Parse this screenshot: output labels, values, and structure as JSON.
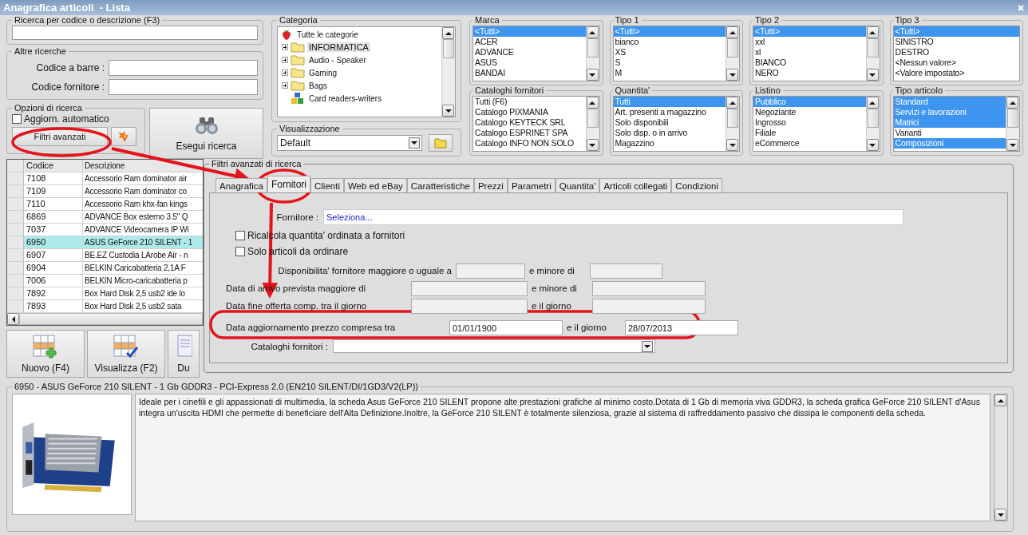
{
  "window": {
    "title": "Anagrafica articoli  - Lista"
  },
  "quick_search": {
    "label": "Ricerca per codice o descrizione (F3)"
  },
  "other_searches": {
    "title": "Altre ricerche",
    "fields": [
      {
        "label": "Codice a barre :"
      },
      {
        "label": "Codice fornitore :"
      }
    ]
  },
  "search_options": {
    "title": "Opzioni di ricerca",
    "auto_update": {
      "label": "Aggiorn. automatico",
      "checked": false
    },
    "advanced_button": "Filtri avanzati"
  },
  "run_button": "Esegui ricerca",
  "category": {
    "title": "Categoria",
    "items": [
      {
        "label": "Tutte le categorie",
        "kind": "root",
        "selected": false
      },
      {
        "label": "INFORMATICA",
        "kind": "folder",
        "selected": true,
        "expanded": false
      },
      {
        "label": "Audio - Speaker",
        "kind": "folder",
        "selected": false,
        "expanded": false
      },
      {
        "label": "Gaming",
        "kind": "folder",
        "selected": false,
        "expanded": false
      },
      {
        "label": "Bags",
        "kind": "folder",
        "selected": false,
        "expanded": false
      },
      {
        "label": "Card readers-writers",
        "kind": "device",
        "selected": false
      }
    ]
  },
  "view": {
    "title": "Visualizzazione",
    "value": "Default"
  },
  "filters": [
    {
      "title": "Marca",
      "scrollable": true,
      "items": [
        {
          "label": "<Tutti>",
          "selected": true
        },
        {
          "label": "ACER",
          "selected": false
        },
        {
          "label": "ADVANCE",
          "selected": false
        },
        {
          "label": "ASUS",
          "selected": false
        },
        {
          "label": "BANDAI",
          "selected": false
        }
      ]
    },
    {
      "title": "Tipo 1",
      "scrollable": true,
      "items": [
        {
          "label": "<Tutti>",
          "selected": true
        },
        {
          "label": "bianco",
          "selected": false
        },
        {
          "label": "XS",
          "selected": false
        },
        {
          "label": "S",
          "selected": false
        },
        {
          "label": "M",
          "selected": false
        }
      ]
    },
    {
      "title": "Tipo 2",
      "scrollable": true,
      "items": [
        {
          "label": "<Tutti>",
          "selected": true
        },
        {
          "label": "xxl",
          "selected": false
        },
        {
          "label": "xl",
          "selected": false
        },
        {
          "label": "BIANCO",
          "selected": false
        },
        {
          "label": "NERO",
          "selected": false
        }
      ]
    },
    {
      "title": "Tipo 3",
      "scrollable": false,
      "items": [
        {
          "label": "<Tutti>",
          "selected": true
        },
        {
          "label": "SINISTRO",
          "selected": false
        },
        {
          "label": "DESTRO",
          "selected": false
        },
        {
          "label": "<Nessun valore>",
          "selected": false
        },
        {
          "label": "<Valore impostato>",
          "selected": false
        }
      ]
    },
    {
      "title": "Cataloghi fornitori",
      "scrollable": true,
      "items": [
        {
          "label": "Tutti (F6)",
          "selected": false
        },
        {
          "label": "Catalogo PIXMANIA",
          "selected": false
        },
        {
          "label": "Catalogo KEYTECK SRL",
          "selected": false
        },
        {
          "label": "Catalogo ESPRINET SPA",
          "selected": false
        },
        {
          "label": "Catalogo INFO NON SOLO",
          "selected": false
        }
      ]
    },
    {
      "title": "Quantita'",
      "scrollable": true,
      "items": [
        {
          "label": "Tutti",
          "selected": true
        },
        {
          "label": "Art. presenti a magazzino",
          "selected": false
        },
        {
          "label": "Solo disponibili",
          "selected": false
        },
        {
          "label": "Solo disp. o in arrivo",
          "selected": false
        },
        {
          "label": "Magazzino",
          "selected": false
        }
      ]
    },
    {
      "title": "Listino",
      "scrollable": true,
      "items": [
        {
          "label": "Pubblico",
          "selected": true
        },
        {
          "label": "Negoziante",
          "selected": false
        },
        {
          "label": "Ingrosso",
          "selected": false
        },
        {
          "label": "Filiale",
          "selected": false
        },
        {
          "label": "eCommerce",
          "selected": false
        }
      ]
    },
    {
      "title": "Tipo articolo",
      "scrollable": true,
      "items": [
        {
          "label": "Standard",
          "selected": true
        },
        {
          "label": "Servizi e lavorazioni",
          "selected": true
        },
        {
          "label": "Matrici",
          "selected": true
        },
        {
          "label": "Varianti",
          "selected": false
        },
        {
          "label": "Composizioni",
          "selected": true
        }
      ]
    }
  ],
  "table": {
    "columns": [
      "Codice",
      "Descrizione"
    ],
    "rows": [
      {
        "code": "7108",
        "description": "Accessorio Ram dominator air",
        "selected": false
      },
      {
        "code": "7109",
        "description": "Accessorio Ram dominator co",
        "selected": false
      },
      {
        "code": "7110",
        "description": "Accessorio Ram khx-fan kings",
        "selected": false
      },
      {
        "code": "6869",
        "description": "ADVANCE Box esterno 3.5\" Q",
        "selected": false
      },
      {
        "code": "7037",
        "description": "ADVANCE Videocamera IP Wi",
        "selected": false
      },
      {
        "code": "6950",
        "description": "ASUS GeForce 210 SILENT - 1",
        "selected": true
      },
      {
        "code": "6907",
        "description": "BE.EZ Custodia LArobe Air - n",
        "selected": false
      },
      {
        "code": "6904",
        "description": "BELKIN Caricabatteria 2,1A F",
        "selected": false
      },
      {
        "code": "7006",
        "description": "BELKIN Micro-caricabatteria p",
        "selected": false
      },
      {
        "code": "7892",
        "description": "Box Hard Disk 2,5  usb2 ide lo",
        "selected": false
      },
      {
        "code": "7893",
        "description": "Box Hard Disk 2,5  usb2 sata",
        "selected": false
      }
    ]
  },
  "actions": [
    {
      "label": "Nuovo (F4)",
      "kind": "new"
    },
    {
      "label": "Visualizza (F2)",
      "kind": "view"
    },
    {
      "label": "Du",
      "kind": "duplicate"
    }
  ],
  "advanced": {
    "title": "Filtri avanzati di ricerca",
    "tabs": [
      {
        "label": "Anagrafica",
        "selected": false
      },
      {
        "label": "Fornitori",
        "selected": true
      },
      {
        "label": "Clienti",
        "selected": false
      },
      {
        "label": "Web ed eBay",
        "selected": false
      },
      {
        "label": "Caratteristiche",
        "selected": false
      },
      {
        "label": "Prezzi",
        "selected": false
      },
      {
        "label": "Parametri",
        "selected": false
      },
      {
        "label": "Quantita'",
        "selected": false
      },
      {
        "label": "Articoli collegati",
        "selected": false
      },
      {
        "label": "Condizioni",
        "selected": false
      }
    ],
    "supplier": {
      "label": "Fornitore :",
      "value": "Seleziona..."
    },
    "checkboxes": [
      {
        "label": "Ricalcola quantita' ordinata a fornitori",
        "checked": false
      },
      {
        "label": "Solo articoli da ordinare",
        "checked": false
      }
    ],
    "ranges": [
      {
        "label": "Disponibilita' fornitore maggiore o uguale a",
        "from": {
          "disabled": true
        },
        "joiner": "e minore di",
        "to": {
          "disabled": true
        }
      },
      {
        "label": "Data di arrivo prevista maggiore di",
        "from": {
          "disabled": true
        },
        "joiner": "e minore di",
        "to": {
          "disabled": true
        }
      },
      {
        "label": "Data fine offerta comp. tra il giorno",
        "from": {
          "disabled": true
        },
        "joiner": "e il giorno",
        "to": {
          "disabled": true
        }
      },
      {
        "label": "Data aggiornamento prezzo compresa tra",
        "from": {
          "value": "01/01/1900",
          "disabled": false
        },
        "joiner": "e il giorno",
        "to": {
          "value": "28/07/2013",
          "disabled": false
        }
      }
    ],
    "catalogs": {
      "label": "Cataloghi fornitori :"
    }
  },
  "detail": {
    "title": "6950 - ASUS GeForce 210 SILENT - 1 Gb GDDR3 - PCI-Express 2.0 (EN210 SILENT/DI/1GD3/V2(LP))",
    "description": "Ideale per i cinefili e gli appassionati di multimedia, la scheda Asus GeForce 210 SILENT propone alte prestazioni grafiche al minimo costo.Dotata di 1 Gb di memoria viva GDDR3, la scheda grafica GeForce 210 SILENT d'Asus integra un'uscita HDMI che permette di beneficiare dell'Alta Definizione.Inoltre, la  GeForce 210 SILENT è totalmente silenziosa, grazie al sistema di raffreddamento passivo che dissipa le componenti della scheda."
  }
}
